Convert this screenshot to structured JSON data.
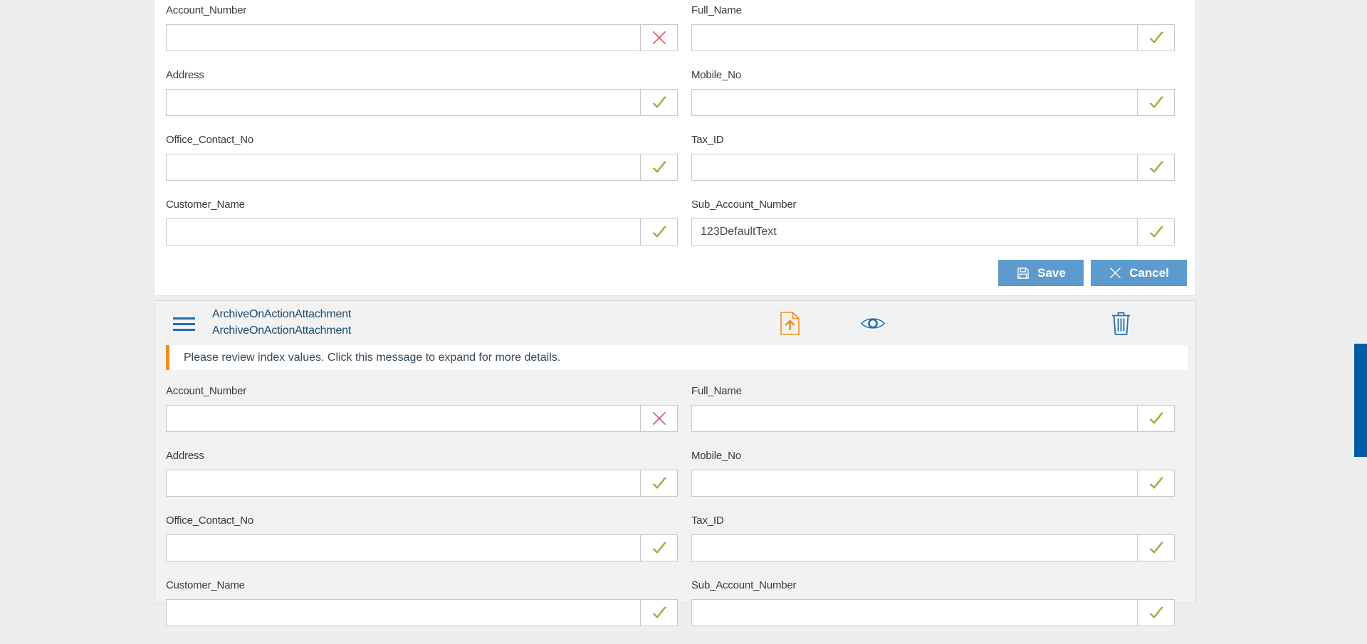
{
  "colors": {
    "page_background": "#eeeeef",
    "card_background": "#ffffff",
    "panel_background": "#f2f2f3",
    "button_blue": "#5d9bce",
    "icon_blue": "#1f6cad",
    "title_navy": "#1d4a6b",
    "warning_orange": "#ef8d22",
    "valid_green": "#74b243",
    "invalid_red": "#dc5061",
    "scrollbar_blue": "#005ca6",
    "field_border": "#c8c8c9"
  },
  "icons": {
    "save": "floppy-disk-icon",
    "cancel": "x-icon",
    "valid": "check-icon",
    "invalid": "x-icon",
    "menu": "hamburger-menu-icon",
    "upload": "file-upload-icon",
    "preview": "eye-icon",
    "delete": "trash-icon"
  },
  "record_form": {
    "fields": [
      {
        "label": "Account_Number",
        "value": "",
        "status": "invalid"
      },
      {
        "label": "Full_Name",
        "value": "",
        "status": "valid"
      },
      {
        "label": "Address",
        "value": "",
        "status": "valid"
      },
      {
        "label": "Mobile_No",
        "value": "",
        "status": "valid"
      },
      {
        "label": "Office_Contact_No",
        "value": "",
        "status": "valid"
      },
      {
        "label": "Tax_ID",
        "value": "",
        "status": "valid"
      },
      {
        "label": "Customer_Name",
        "value": "",
        "status": "valid"
      },
      {
        "label": "Sub_Account_Number",
        "value": "123DefaultText",
        "status": "valid"
      }
    ],
    "buttons": {
      "save": "Save",
      "cancel": "Cancel"
    }
  },
  "attachment_panel": {
    "title_lines": [
      "ArchiveOnActionAttachment",
      "ArchiveOnActionAttachment"
    ],
    "warning_message": "Please review index values. Click this message to expand for more details.",
    "fields": [
      {
        "label": "Account_Number",
        "value": "",
        "status": "invalid"
      },
      {
        "label": "Full_Name",
        "value": "",
        "status": "valid"
      },
      {
        "label": "Address",
        "value": "",
        "status": "valid"
      },
      {
        "label": "Mobile_No",
        "value": "",
        "status": "valid"
      },
      {
        "label": "Office_Contact_No",
        "value": "",
        "status": "valid"
      },
      {
        "label": "Tax_ID",
        "value": "",
        "status": "valid"
      },
      {
        "label": "Customer_Name",
        "value": "",
        "status": "valid"
      },
      {
        "label": "Sub_Account_Number",
        "value": "",
        "status": "valid"
      }
    ]
  }
}
